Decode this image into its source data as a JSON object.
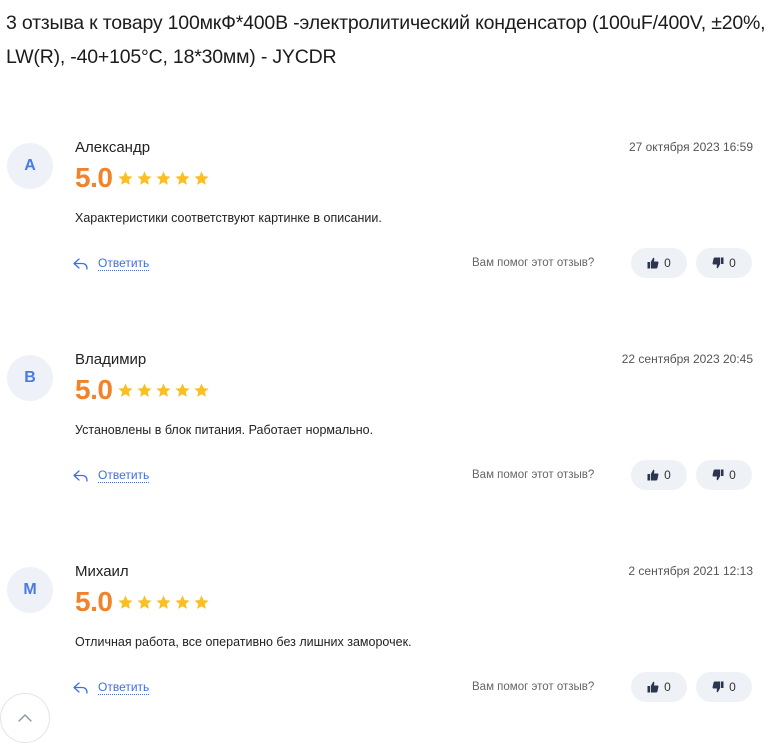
{
  "title": "3 отзыва к товару 100мкФ*400В -электролитический конденсатор (100uF/400V, ±20%, LW(R), -40+105°C, 18*30мм) - JYCDR",
  "colors": {
    "accent": "#3d6fe0",
    "score": "#f0842c",
    "star": "#fbbf24",
    "avatar_bg": "#eef1f8"
  },
  "reviews": [
    {
      "initial": "А",
      "author": "Александр",
      "date": "27 октября 2023 16:59",
      "score": "5.0",
      "stars": 5,
      "text": "Характеристики соответствуют картинке в описании.",
      "reply_label": "Ответить",
      "helpful_question": "Вам помог этот отзыв?",
      "likes": "0",
      "dislikes": "0"
    },
    {
      "initial": "В",
      "author": "Владимир",
      "date": "22 сентября 2023 20:45",
      "score": "5.0",
      "stars": 5,
      "text": "Установлены в блок питания. Работает нормально.",
      "reply_label": "Ответить",
      "helpful_question": "Вам помог этот отзыв?",
      "likes": "0",
      "dislikes": "0"
    },
    {
      "initial": "М",
      "author": "Михаил",
      "date": "2 сентября 2021 12:13",
      "score": "5.0",
      "stars": 5,
      "text": "Отличная работа, все оперативно без лишних заморочек.",
      "reply_label": "Ответить",
      "helpful_question": "Вам помог этот отзыв?",
      "likes": "0",
      "dislikes": "0"
    }
  ],
  "icons": {
    "star": "star-icon",
    "reply": "reply-arrow-icon",
    "like": "thumbs-up-icon",
    "dislike": "thumbs-down-icon",
    "scroll_top": "chevron-up-icon"
  }
}
